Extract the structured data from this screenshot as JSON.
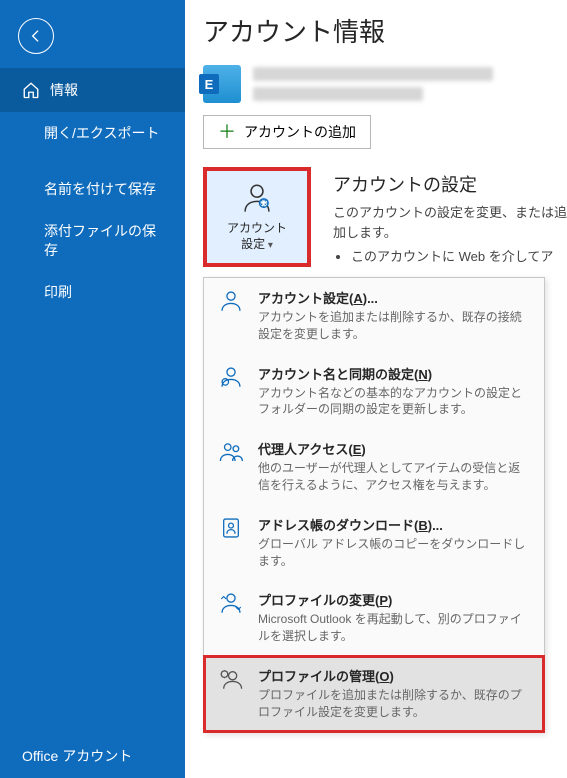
{
  "sidebar": {
    "items": {
      "info": "情報",
      "open_export": "開く/エクスポート",
      "save_as": "名前を付けて保存",
      "save_attachments": "添付ファイルの保存",
      "print": "印刷",
      "office_account": "Office アカウント"
    }
  },
  "main": {
    "page_title": "アカウント情報",
    "add_account": "アカウントの追加",
    "dropdown_label": "アカウント\n設定",
    "section": {
      "title": "アカウントの設定",
      "desc": "このアカウントの設定を変更、または追加します。",
      "bullet": "このアカウントに Web を介してア"
    },
    "menu": [
      {
        "title": "アカウント設定(A)...",
        "desc": "アカウントを追加または削除するか、既存の接続設定を変更します。"
      },
      {
        "title": "アカウント名と同期の設定(N)",
        "desc": "アカウント名などの基本的なアカウントの設定とフォルダーの同期の設定を更新します。"
      },
      {
        "title": "代理人アクセス(E)",
        "desc": "他のユーザーが代理人としてアイテムの受信と返信を行えるように、アクセス権を与えます。"
      },
      {
        "title": "アドレス帳のダウンロード(B)...",
        "desc": "グローバル アドレス帳のコピーをダウンロードします。"
      },
      {
        "title": "プロファイルの変更(P)",
        "desc": "Microsoft Outlook を再起動して、別のプロファイルを選択します。"
      },
      {
        "title": "プロファイルの管理(O)",
        "desc": "プロファイルを追加または削除するか、既存のプロファイル設定を変更します。"
      }
    ]
  }
}
